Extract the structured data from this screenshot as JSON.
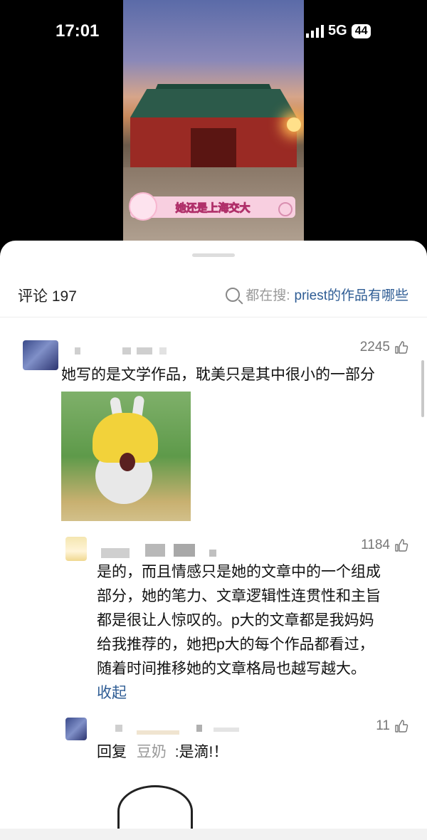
{
  "status_bar": {
    "time": "17:01",
    "network": "5G",
    "battery": "44"
  },
  "video": {
    "caption": "她还是上海交大"
  },
  "comments_header": {
    "title": "评论 197",
    "search_prefix": "都在搜:",
    "search_keyword": "priest的作品有哪些"
  },
  "comments": [
    {
      "likes": "2245",
      "text": "她写的是文学作品，耽美只是其中很小的一部分",
      "has_sticker": true
    },
    {
      "likes": "1184",
      "lines": [
        "是的，而且情感只是她的文章中的一个组成",
        "部分，她的笔力、文章逻辑性连贯性和主旨",
        "都是很让人惊叹的。p大的文章都是我妈妈",
        "给我推荐的，她把p大的每个作品都看过，",
        "随着时间推移她的文章格局也越写越大。"
      ],
      "collapse_label": "收起"
    },
    {
      "likes": "11",
      "reply_prefix": "回复",
      "reply_to": "豆奶",
      "text": ":是滴!！"
    }
  ],
  "colors": {
    "link": "#2e5c94",
    "muted": "#999999"
  }
}
